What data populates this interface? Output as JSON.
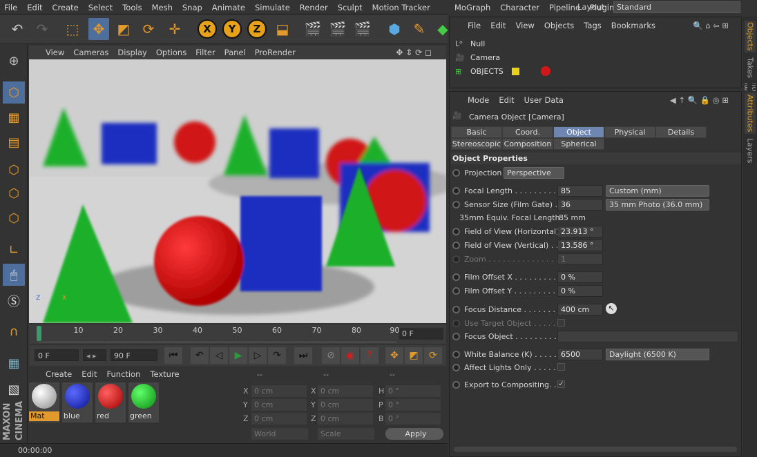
{
  "menubar": {
    "items": [
      "File",
      "Edit",
      "Create",
      "Select",
      "Tools",
      "Mesh",
      "Snap",
      "Animate",
      "Simulate",
      "Render",
      "Sculpt",
      "Motion Tracker",
      "MoGraph",
      "Character",
      "Pipeline",
      "Plugins"
    ],
    "layout_label": "Layout:",
    "layout_value": "Standard"
  },
  "toolbar": {
    "x": "X",
    "y": "Y",
    "z": "Z"
  },
  "viewport": {
    "menu": [
      "View",
      "Cameras",
      "Display",
      "Options",
      "Filter",
      "Panel",
      "ProRender"
    ]
  },
  "timeline": {
    "ticks": [
      "0",
      "10",
      "20",
      "30",
      "40",
      "50",
      "60",
      "70",
      "80",
      "90"
    ],
    "current_frame": "0 F"
  },
  "transport": {
    "start": "0 F",
    "end": "90 F"
  },
  "materials": {
    "menu": [
      "Create",
      "Edit",
      "Function",
      "Texture"
    ],
    "items": [
      {
        "name": "Mat",
        "color": "#d8d8d8"
      },
      {
        "name": "blue",
        "color": "#1a2cc8"
      },
      {
        "name": "red",
        "color": "#d01818"
      },
      {
        "name": "green",
        "color": "#18b020"
      }
    ]
  },
  "coords": {
    "head": [
      "--",
      "--",
      "--"
    ],
    "rows": [
      [
        "X",
        "0 cm",
        "X",
        "0 cm",
        "H",
        "0 °"
      ],
      [
        "Y",
        "0 cm",
        "Y",
        "0 cm",
        "P",
        "0 °"
      ],
      [
        "Z",
        "0 cm",
        "Z",
        "0 cm",
        "B",
        "0 °"
      ]
    ],
    "world": "World",
    "scale": "Scale",
    "apply": "Apply"
  },
  "status": "00:00:00",
  "objects": {
    "menu": [
      "File",
      "Edit",
      "View",
      "Objects",
      "Tags",
      "Bookmarks"
    ],
    "items": [
      "Null",
      "Camera",
      "OBJECTS"
    ]
  },
  "attributes": {
    "menu": [
      "Mode",
      "Edit",
      "User Data"
    ],
    "title": "Camera Object [Camera]",
    "tabs": [
      "Basic",
      "Coord.",
      "Object",
      "Physical",
      "Details",
      "Stereoscopic",
      "Composition",
      "Spherical"
    ],
    "section": "Object Properties",
    "projection_label": "Projection",
    "projection": "Perspective",
    "focal_length_label": "Focal Length . . . . . . . . . .",
    "focal_length": "85",
    "focal_preset": "Custom (mm)",
    "sensor_label": "Sensor Size (Film Gate) . .",
    "sensor": "36",
    "sensor_preset": "35 mm Photo (36.0 mm)",
    "equiv_label": "35mm Equiv. Focal Length:",
    "equiv": "85 mm",
    "fovh_label": "Field of View (Horizontal)",
    "fovh": "23.913 °",
    "fovv_label": "Field of View (Vertical) . .",
    "fovv": "13.586 °",
    "zoom_label": "Zoom . . . . . . . . . . . . . . .",
    "zoom": "1",
    "offx_label": "Film Offset X . . . . . . . . .",
    "offx": "0 %",
    "offy_label": "Film Offset Y . . . . . . . . .",
    "offy": "0 %",
    "focusd_label": "Focus Distance . . . . . . . .",
    "focusd": "400 cm",
    "usetarget_label": "Use Target Object . . . . . .",
    "focuso_label": "Focus Object . . . . . . . . . .",
    "wb_label": "White Balance (K) . . . . . .",
    "wb": "6500",
    "wb_preset": "Daylight (6500 K)",
    "affect_label": "Affect Lights Only . . . . . .",
    "export_label": "Export to Compositing. . .",
    "export_check": "✓"
  },
  "sidetabs": [
    "Objects",
    "Takes",
    "Content Browser",
    "Attributes",
    "Layers"
  ]
}
